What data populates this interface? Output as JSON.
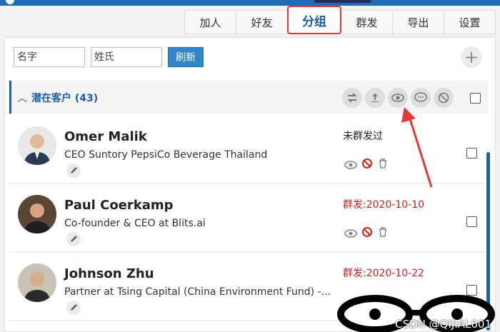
{
  "tabs": [
    "加人",
    "好友",
    "分组",
    "群发",
    "导出",
    "设置"
  ],
  "active_tab": "分组",
  "search": {
    "name_placeholder": "名字",
    "surname_placeholder": "姓氏",
    "refresh_label": "刷新",
    "add_symbol": "+"
  },
  "group": {
    "chevron": "︿",
    "title": "潜在客户 (43)",
    "icons": [
      "swap-icon",
      "upload-icon",
      "eye-icon",
      "comment-icon",
      "block-icon"
    ]
  },
  "contacts": [
    {
      "name": "Omer Malik",
      "title": "CEO Suntory PepsiCo Beverage Thailand",
      "status": "未群发过",
      "status_color": "#222222"
    },
    {
      "name": "Paul Coerkamp",
      "title": "Co-founder & CEO at Blits.ai",
      "status": "群发:2020-10-10",
      "status_color": "#d02020"
    },
    {
      "name": "Johnson Zhu",
      "title": "Partner at Tsing Capital (China Environment Fund) -...",
      "status": "群发:2020-10-22",
      "status_color": "#d02020"
    }
  ],
  "watermark": "CSDN @QIJIAL601",
  "colors": {
    "accent": "#1a5fa8",
    "highlight": "#e53935",
    "refresh": "#2f86c9"
  }
}
